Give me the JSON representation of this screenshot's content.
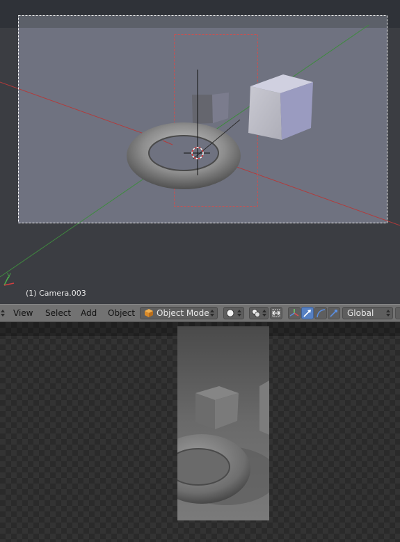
{
  "viewport": {
    "object_label": "(1) Camera.003",
    "axis_gizmo": {
      "y_label": "y"
    },
    "colors": {
      "x_axis": "#b23a3a",
      "y_axis": "#3f8a3f",
      "background": "#393939",
      "camera_frame": "#6f7280"
    }
  },
  "header": {
    "menus": [
      "View",
      "Select",
      "Add",
      "Object"
    ],
    "mode_label": "Object Mode",
    "orientation_label": "Global",
    "icons": [
      "editor-type-icon",
      "object-cube-icon",
      "viewport-shading-icon",
      "pivot-point-icon",
      "snap-icon",
      "manipulator-translate-icon",
      "manipulator-rotate-icon",
      "manipulator-scale-icon"
    ]
  },
  "image_editor": {
    "colors": {
      "checker_dark": "#2a2a2a",
      "checker_light": "#333333"
    }
  }
}
